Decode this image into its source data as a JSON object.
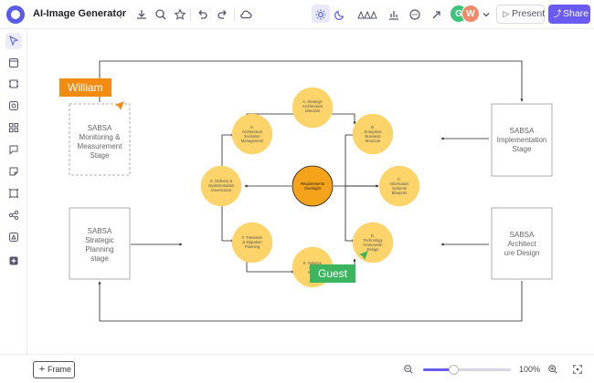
{
  "app": {
    "title": "AI-Image Generator"
  },
  "toolbar": {
    "present_label": "Present",
    "share_label": "Share",
    "present_icon": "play-icon",
    "share_icon": "share-icon",
    "icons": [
      "more-icon",
      "download-icon",
      "search-icon",
      "star-icon",
      "undo-icon",
      "redo-icon",
      "cloud-icon",
      "sun-icon",
      "moon-icon",
      "shapes-icon",
      "chart-icon",
      "comment-icon",
      "arrow-icon"
    ],
    "collaborators": [
      {
        "initial": "G",
        "color": "#3cc47c"
      },
      {
        "initial": "W",
        "color": "#f08a6a"
      }
    ]
  },
  "sidebar": {
    "icons": [
      "pointer-icon",
      "frame-icon",
      "template-icon",
      "media-icon",
      "components-icon",
      "chat-icon",
      "sticky-note-icon",
      "image-frame-icon",
      "connect-icon",
      "shape-icon",
      "add-icon"
    ]
  },
  "diagram": {
    "boxes": {
      "monitoring": "SABSA\nMonitoring &\nMeasurement\nStage",
      "implementation": "SABSA\nImplementation\nStage",
      "strategic": "SABSA\nStrategic\nPlanning\nstage",
      "architecture": "SABSA\nArchitect\nure Design"
    },
    "circles": {
      "A": "A. Strategic\nArchitecture\nDirection",
      "B": "B.\nEnterprise\nBusiness\nStructure",
      "C": "C.\nInformation\nSystems\nBlueprint",
      "D": "D.\nTechnology\nFramework\nDesign",
      "E": "E. Solution\nGov\nImpro",
      "F": "F. Transition\n& Migration\nPlanning",
      "G": "G. Delivery &\nImplementation\nGovernance",
      "H": "H.\nArchitecture\nEvolution\nManagement",
      "center": "Requirements\nOversight"
    },
    "colors": {
      "circle": "#fcd46a",
      "center": "#f5a31a",
      "line": "#222222"
    }
  },
  "cursors": {
    "william": {
      "name": "William",
      "color": "#f28c10"
    },
    "guest": {
      "name": "Guest",
      "color": "#3cb65e"
    }
  },
  "bottom": {
    "frame_label": "Frame",
    "zoom_label": "100%",
    "zoom_fraction": 0.35
  }
}
